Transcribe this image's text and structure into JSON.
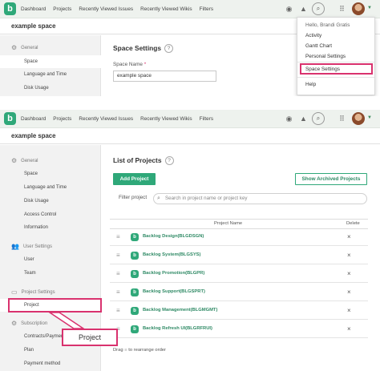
{
  "colors": {
    "accent": "#2fa879",
    "highlight": "#d9326e",
    "sidebar_bg": "#f2f2f2",
    "topbar_bg": "#eef2ee"
  },
  "nav": [
    "Dashboard",
    "Projects",
    "Recently Viewed Issues",
    "Recently Viewed Wikis",
    "Filters"
  ],
  "icons": {
    "logo": "backlog-logo-icon",
    "watch": "eye-icon",
    "notifications": "bell-icon",
    "search": "search-icon",
    "apps": "grid-icon",
    "menu": "chevron-down-icon"
  },
  "space_name": "example space",
  "screenshot1": {
    "sidebar": {
      "section_general": "General",
      "items": [
        "Space",
        "Language and Time",
        "Disk Usage"
      ]
    },
    "main": {
      "title": "Space Settings",
      "help": "?",
      "field_label": "Space Name",
      "required_mark": "*",
      "field_value": "example space"
    },
    "dropdown": {
      "greeting": "Hello, Brandi Gratis",
      "items": [
        "Activity",
        "Gantt Chart",
        "Personal Settings",
        "Space Settings",
        "Help"
      ]
    }
  },
  "screenshot2": {
    "sidebar": {
      "section_general": "General",
      "general_items": [
        "Space",
        "Language and Time",
        "Disk Usage",
        "Access Control",
        "Information"
      ],
      "section_user": "User Settings",
      "user_items": [
        "User",
        "Team"
      ],
      "section_project": "Project Settings",
      "project_items": [
        "Project"
      ],
      "section_subscription": "Subscription",
      "subscription_items": [
        "Contracts/Payment",
        "Plan",
        "Payment method"
      ]
    },
    "main": {
      "title": "List of Projects",
      "help": "?",
      "add_button": "Add Project",
      "archived_button": "Show Archived Projects",
      "filter_label": "Filter project",
      "filter_placeholder": "Search in project name or project key",
      "col_name": "Project Name",
      "col_delete": "Delete",
      "projects": [
        "Backlog Design(BLGDSGN)",
        "Backlog System(BLGSYS)",
        "Backlog Promotion(BLGPR)",
        "Backlog Support(BLGSPRT)",
        "Backlog Management(BLGMGMT)",
        "Backlog Refresh UI(BLGRFRUI)"
      ],
      "delete_symbol": "×",
      "drag_hint_a": "Drag",
      "drag_hint_b": "to rearrange order"
    },
    "callout": "Project"
  }
}
